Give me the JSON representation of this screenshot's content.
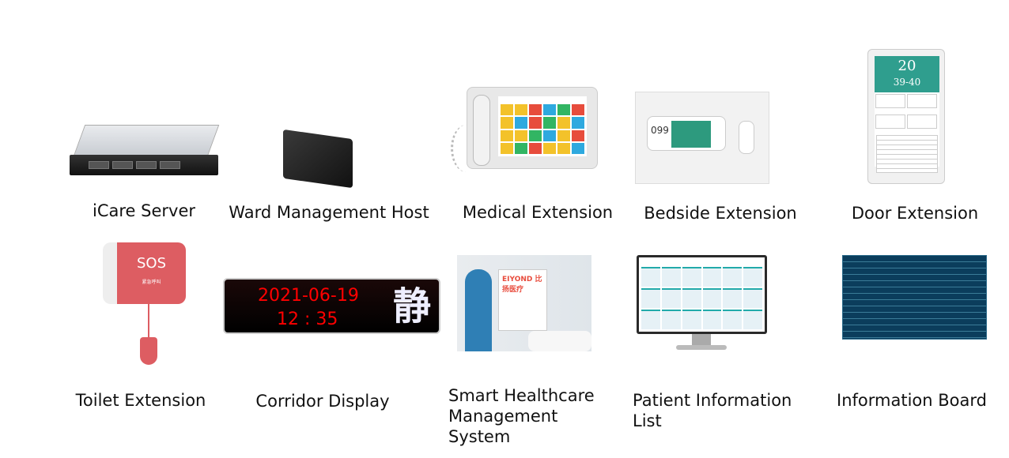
{
  "products": [
    {
      "label": "iCare Server",
      "icon": "server-image"
    },
    {
      "label": "Ward Management Host",
      "icon": "host-box-image"
    },
    {
      "label": "Medical Extension",
      "icon": "nurse-station-phone-image"
    },
    {
      "label": "Bedside Extension",
      "icon": "bedside-terminal-image",
      "screen_text": "099"
    },
    {
      "label": "Door Extension",
      "icon": "door-tablet-image",
      "room": "20",
      "bed": "39-40"
    },
    {
      "label": "Toilet Extension",
      "icon": "sos-button-image",
      "button_text": "SOS",
      "sub_text": "紧急呼叫"
    },
    {
      "label": "Corridor Display",
      "icon": "led-display-image",
      "date": "2021-06-19",
      "time": "12 : 35",
      "quiet_char": "静"
    },
    {
      "label": "Smart Healthcare Management System",
      "label_lines": [
        "Smart Healthcare",
        "Management",
        "System"
      ],
      "icon": "healthcare-system-photo",
      "logo": "EIYOND 比扬医疗"
    },
    {
      "label": "Patient Information List",
      "label_lines": [
        "Patient Information",
        "List"
      ],
      "icon": "monitor-image"
    },
    {
      "label": "Information Board",
      "icon": "info-board-image"
    }
  ],
  "colors": {
    "led_red": "#ff0000",
    "sos_red": "#dd5d62",
    "door_teal": "#2f9e8e"
  }
}
